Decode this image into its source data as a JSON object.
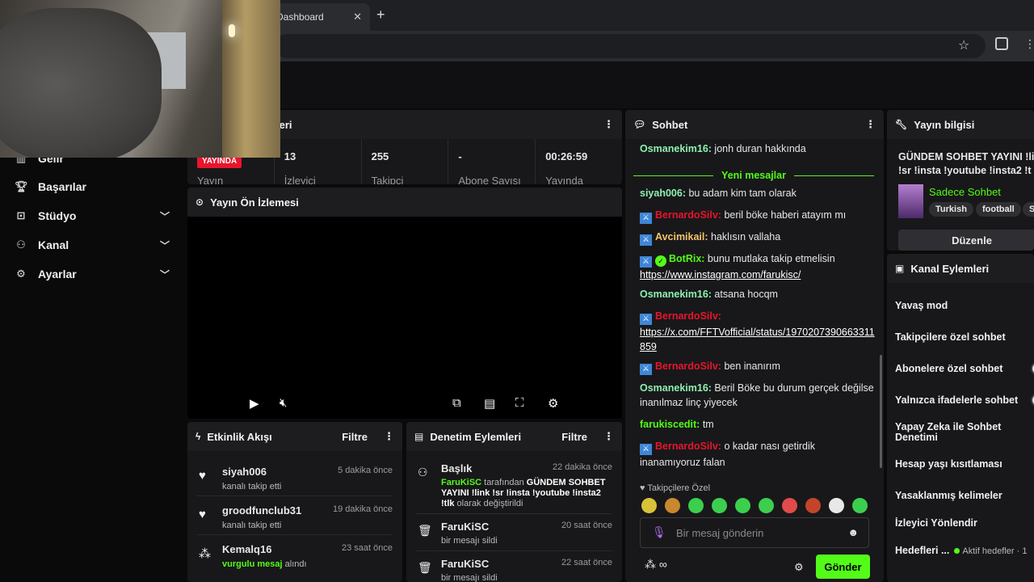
{
  "browser": {
    "tab_title": "Dashboard",
    "tab_close": "✕",
    "new_tab": "+"
  },
  "sidebar": {
    "items": [
      {
        "label": "Gelir",
        "icon": "chart-icon"
      },
      {
        "label": "Başarılar",
        "icon": "trophy-icon"
      },
      {
        "label": "Stüdyo",
        "icon": "studio-icon"
      },
      {
        "label": "Kanal",
        "icon": "channel-icon"
      },
      {
        "label": "Ayarlar",
        "icon": "settings-icon"
      }
    ]
  },
  "stats": {
    "header_fragment": "leri",
    "live_badge": "YAYINDA",
    "live_label": "Yayın",
    "viewers_value": "13",
    "viewers_label": "İzleyici",
    "followers_value": "255",
    "followers_label": "Takipçi",
    "subs_value": "-",
    "subs_label": "Abone Sayısı",
    "uptime_value": "00:26:59",
    "uptime_label": "Yayında"
  },
  "preview": {
    "title": "Yayın Ön İzlemesi"
  },
  "activity": {
    "title": "Etkinlik Akışı",
    "filter": "Filtre",
    "items": [
      {
        "name": "siyah006",
        "time": "5 dakika önce",
        "sub": "kanalı takip etti"
      },
      {
        "name": "groodfunclub31",
        "time": "19 dakika önce",
        "sub": "kanalı takip etti"
      },
      {
        "name": "Kemalq16",
        "time": "23 saat önce",
        "sub_highlight": "vurgulu mesaj",
        "sub_rest": " alındı"
      }
    ]
  },
  "moderation": {
    "title": "Denetim Eylemleri",
    "filter": "Filtre",
    "items": [
      {
        "name": "Başlık",
        "time": "22 dakika önce",
        "actor": "FaruKiSC",
        "mid": " tarafından ",
        "new_title": "GÜNDEM SOHBET YAYINI !link !sr !insta !youtube !insta2 !tlk",
        "end": " olarak değiştirildi"
      },
      {
        "name": "FaruKiSC",
        "time": "20 saat önce",
        "sub": "bir mesajı sildi"
      },
      {
        "name": "FaruKiSC",
        "time": "22 saat önce",
        "sub": "bir mesajı sildi"
      }
    ]
  },
  "chat": {
    "title": "Sohbet",
    "new_messages": "Yeni mesajlar",
    "messages": [
      {
        "user": "Osmanekim16:",
        "text": " jonh duran hakkında"
      },
      {
        "user": "siyah006:",
        "text": " bu adam kim tam olarak"
      },
      {
        "user": "BernardoSilv:",
        "text": " beril böke haberi atayım mı"
      },
      {
        "user": "Avcimikail:",
        "text": " haklısın vallaha"
      },
      {
        "user": "BotRix:",
        "text": " bunu mutlaka takip etmelisin",
        "link": "https://www.instagram.com/farukisc/"
      },
      {
        "user": "Osmanekim16:",
        "text": " atsana hocqm"
      },
      {
        "user": "BernardoSilv:",
        "link": "https://x.com/FFTVofficial/status/1970207390663311859"
      },
      {
        "user": "BernardoSilv:",
        "text": " ben inanırım"
      },
      {
        "user": "Osmanekim16:",
        "text": " Beril Böke bu durum gerçek değilse inanılmaz linç yiyecek"
      },
      {
        "user": "farukiscedit:",
        "text": " tm"
      },
      {
        "user": "BernardoSilv:",
        "text": " o kadar nası getirdik inanamıyoruz falan"
      }
    ],
    "followers_only": "Takipçilere Özel",
    "input_placeholder": "Bir mesaj gönderin",
    "send": "Gönder",
    "infinity": "∞"
  },
  "info": {
    "title": "Yayın bilgisi",
    "stream_title": "GÜNDEM SOHBET YAYINI !li",
    "stream_title2": "!sr !insta !youtube !insta2 !t",
    "category": "Sadece Sohbet",
    "tags": [
      "Turkish",
      "football",
      "S"
    ],
    "edit": "Düzenle"
  },
  "actions": {
    "title": "Kanal Eylemleri",
    "items": [
      "Yavaş mod",
      "Takipçilere özel sohbet",
      "Abonelere özel sohbet",
      "Yalnızca ifadelerle sohbet",
      "Yapay Zeka ile Sohbet Denetimi",
      "Hesap yaşı kısıtlaması",
      "Yasaklanmış kelimeler",
      "İzleyici Yönlendir",
      "Hedefleri ..."
    ],
    "active_goals": "Aktif hedefler · 1"
  }
}
